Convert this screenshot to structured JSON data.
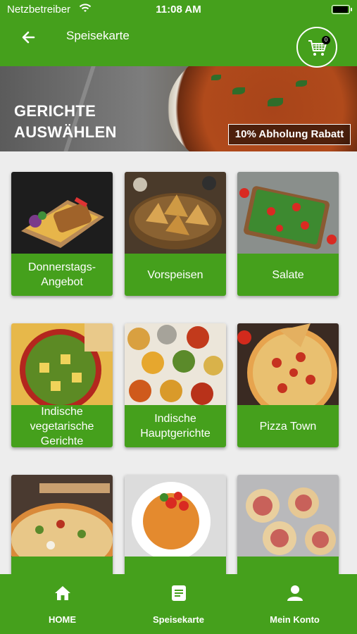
{
  "status_bar": {
    "carrier": "Netzbetreiber",
    "time": "11:08 AM"
  },
  "app_bar": {
    "title": "Speisekarte",
    "cart_count": "0"
  },
  "banner": {
    "title_line1": "GERICHTE",
    "title_line2": "AUSWÄHLEN",
    "discount": "10% Abholung Rabatt"
  },
  "categories": [
    {
      "label": "Donnerstags-Angebot"
    },
    {
      "label": "Vorspeisen"
    },
    {
      "label": "Salate"
    },
    {
      "label": "Indische vegetarische Gerichte"
    },
    {
      "label": "Indische Hauptgerichte"
    },
    {
      "label": "Pizza Town"
    },
    {
      "label": ""
    },
    {
      "label": ""
    },
    {
      "label": ""
    }
  ],
  "bottom_nav": {
    "home": "HOME",
    "menu": "Speisekarte",
    "account": "Mein Konto"
  },
  "colors": {
    "primary": "#45a01c",
    "card_bg": "#ffffff",
    "page_bg": "#ededed"
  }
}
